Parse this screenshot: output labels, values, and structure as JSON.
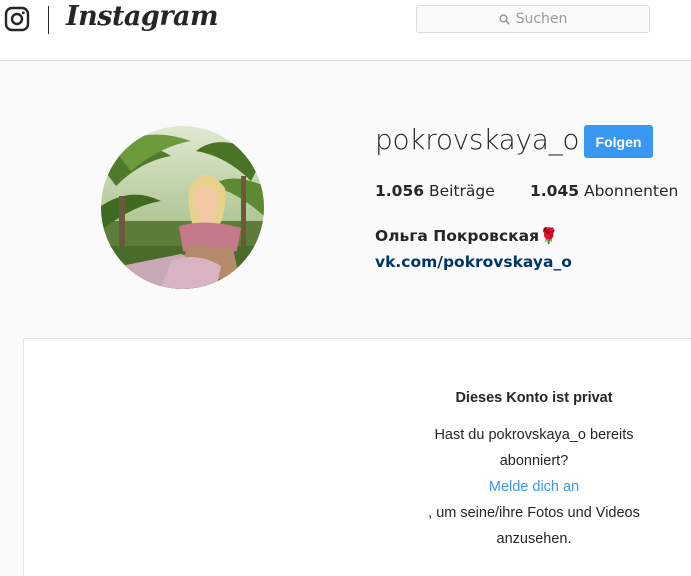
{
  "header": {
    "logo_icon": "instagram-camera-icon",
    "wordmark": "Instagram",
    "search": {
      "placeholder": "Suchen",
      "icon": "search-icon"
    }
  },
  "profile": {
    "username": "pokrovskaya_o",
    "follow_label": "Folgen",
    "posts_count": "1.056",
    "posts_label": "Beiträge",
    "followers_count": "1.045",
    "followers_label": "Abonnenten",
    "full_name": "Ольга Покровская",
    "full_name_emoji": "🌹",
    "website": "vk.com/pokrovskaya_o"
  },
  "private": {
    "title": "Dieses Konto ist privat",
    "line1": "Hast du pokrovskaya_o bereits abonniert?",
    "login_link": "Melde dich an",
    "line2": ", um seine/ihre Fotos und Videos anzusehen."
  },
  "colors": {
    "accent": "#3897f0",
    "link_dark": "#003569",
    "text": "#262626",
    "background": "#fafafa"
  }
}
